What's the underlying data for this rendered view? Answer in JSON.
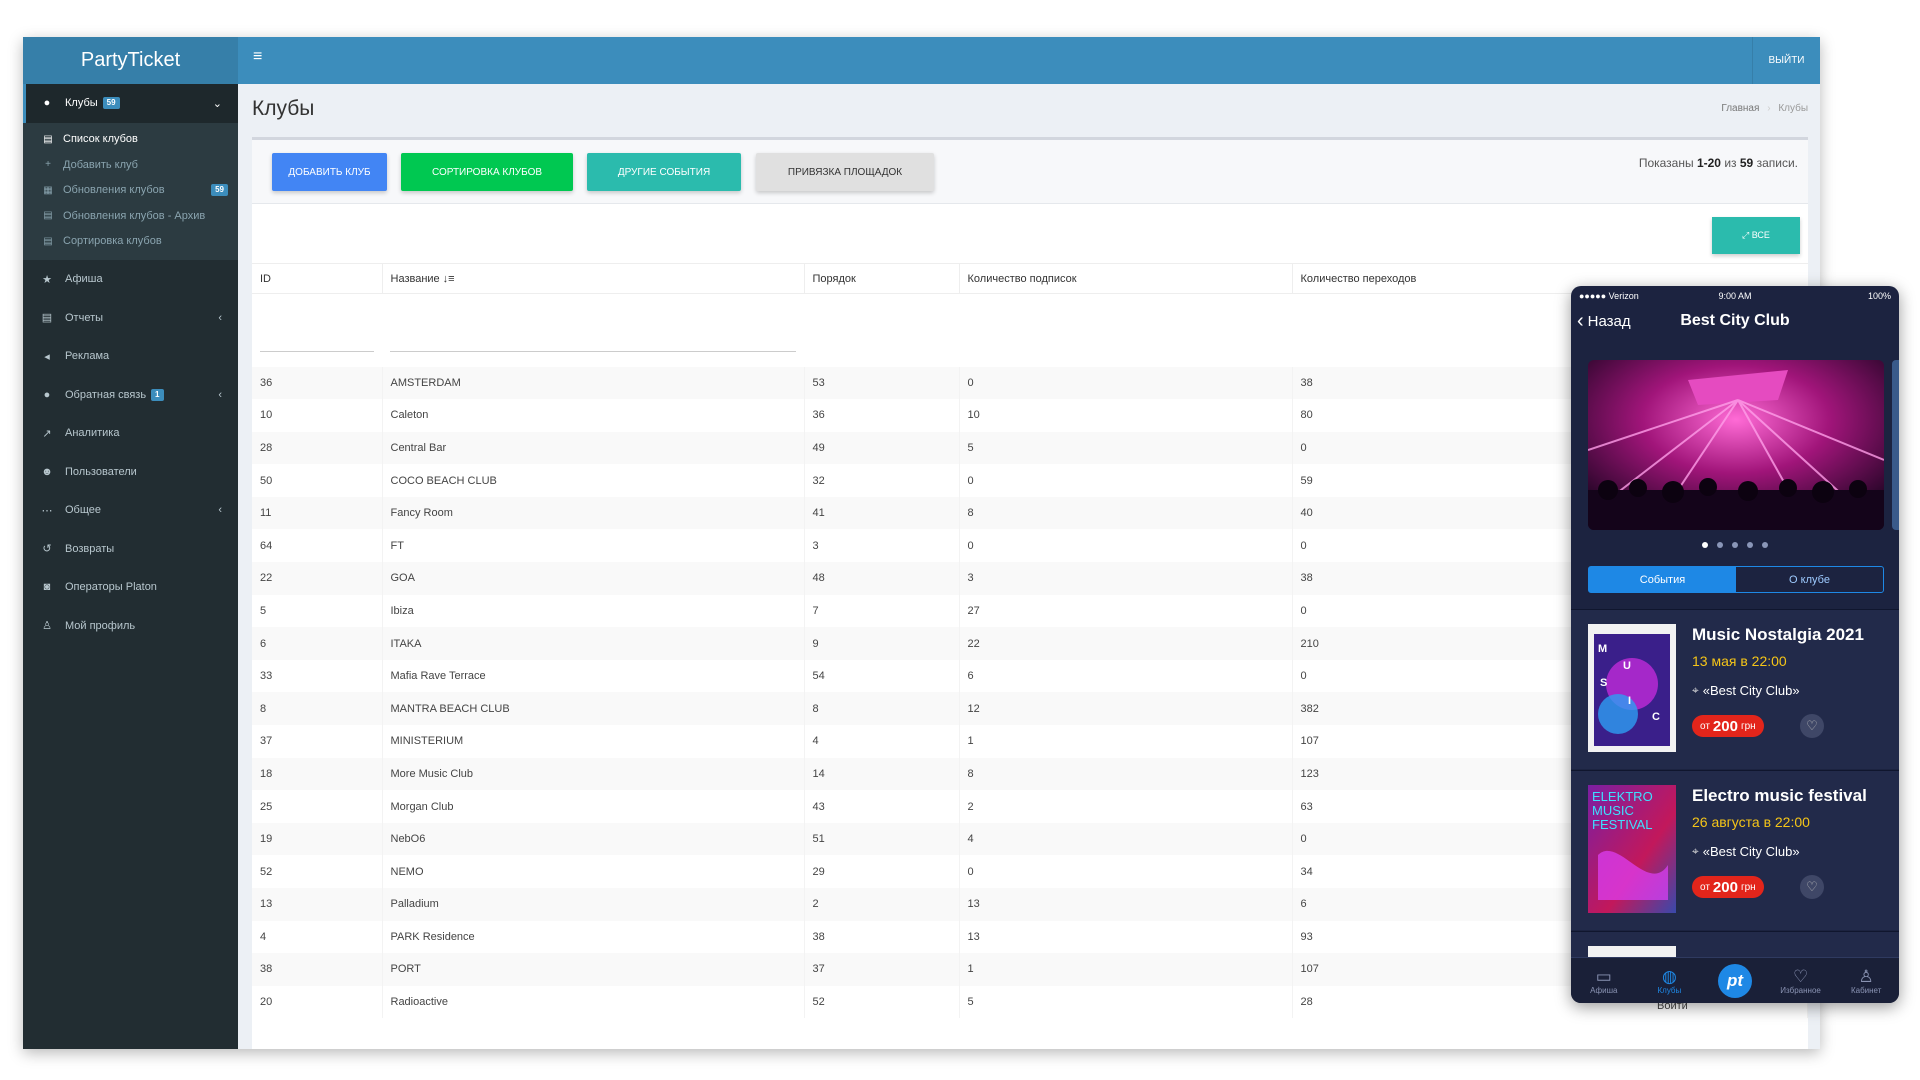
{
  "brand": "PartyTicket",
  "topbar": {
    "menu_icon": "≡",
    "logout": "ВЫЙТИ"
  },
  "sidebar": {
    "items": [
      {
        "icon": "●",
        "label": "Клубы",
        "badge": "59",
        "chev": "⌄"
      },
      {
        "icon": "★",
        "label": "Афиша"
      },
      {
        "icon": "▤",
        "label": "Отчеты",
        "chev": "‹"
      },
      {
        "icon": "◂",
        "label": "Реклама"
      },
      {
        "icon": "●",
        "label": "Обратная связь",
        "badge": "1",
        "chev": "‹"
      },
      {
        "icon": "↗",
        "label": "Аналитика"
      },
      {
        "icon": "☻",
        "label": "Пользователи"
      },
      {
        "icon": "⋯",
        "label": "Общее",
        "chev": "‹"
      },
      {
        "icon": "↺",
        "label": "Возвраты"
      },
      {
        "icon": "◙",
        "label": "Операторы Platon"
      },
      {
        "icon": "♙",
        "label": "Мой профиль"
      }
    ],
    "submenu": [
      {
        "icon": "▤",
        "label": "Список клубов"
      },
      {
        "icon": "+",
        "label": "Добавить клуб"
      },
      {
        "icon": "▦",
        "label": "Обновления клубов",
        "badge": "59"
      },
      {
        "icon": "▤",
        "label": "Обновления клубов - Архив"
      },
      {
        "icon": "▤",
        "label": "Сортировка клубов"
      }
    ]
  },
  "page": {
    "title": "Клубы",
    "breadcrumb": {
      "home": "Главная",
      "sep": "›",
      "current": "Клубы"
    }
  },
  "toolbar": {
    "add": "ДОБАВИТЬ КЛУБ",
    "sort": "СОРТИРОВКА КЛУБОВ",
    "events": "ДРУГИЕ СОБЫТИЯ",
    "bind": "ПРИВЯЗКА ПЛОЩАДОК",
    "shown_prefix": "Показаны",
    "shown_range": "1-20",
    "shown_of": "из",
    "shown_total": "59",
    "shown_suffix": "записи.",
    "all": "⤢ ВСЕ"
  },
  "table": {
    "headers": [
      "ID",
      "Название",
      "Порядок",
      "Количество подписок",
      "Количество переходов"
    ],
    "rows": [
      [
        "36",
        "AMSTERDAM",
        "53",
        "0",
        "38"
      ],
      [
        "10",
        "Caleton",
        "36",
        "10",
        "80"
      ],
      [
        "28",
        "Central Bar",
        "49",
        "5",
        "0"
      ],
      [
        "50",
        "COCO BEACH CLUB",
        "32",
        "0",
        "59"
      ],
      [
        "11",
        "Fancy Room",
        "41",
        "8",
        "40"
      ],
      [
        "64",
        "FT",
        "3",
        "0",
        "0"
      ],
      [
        "22",
        "GOA",
        "48",
        "3",
        "38"
      ],
      [
        "5",
        "Ibiza",
        "7",
        "27",
        "0"
      ],
      [
        "6",
        "ITAKA",
        "9",
        "22",
        "210"
      ],
      [
        "33",
        "Mafia Rave Terrace",
        "54",
        "6",
        "0"
      ],
      [
        "8",
        "MANTRA BEACH CLUB",
        "8",
        "12",
        "382"
      ],
      [
        "37",
        "MINISTERIUM",
        "4",
        "1",
        "107"
      ],
      [
        "18",
        "More Music Club",
        "14",
        "8",
        "123"
      ],
      [
        "25",
        "Morgan Club",
        "43",
        "2",
        "63"
      ],
      [
        "19",
        "NebO6",
        "51",
        "4",
        "0"
      ],
      [
        "52",
        "NEMO",
        "29",
        "0",
        "34"
      ],
      [
        "13",
        "Palladium",
        "2",
        "13",
        "6"
      ],
      [
        "4",
        "PARK Residence",
        "38",
        "13",
        "93"
      ],
      [
        "38",
        "PORT",
        "37",
        "1",
        "107"
      ],
      [
        "20",
        "Radioactive",
        "52",
        "5",
        "28"
      ]
    ],
    "login_link": "Войти"
  },
  "phone": {
    "status": {
      "carrier": "●●●●● Verizon",
      "time": "9:00 AM",
      "battery": "100%"
    },
    "back": "Назад",
    "title": "Best City Club",
    "seg_events": "События",
    "seg_about": "О клубе",
    "events": [
      {
        "title": "Music Nostalgia 2021",
        "date": "13 мая в 22:00",
        "venue": "«Best City Club»",
        "price_from": "от",
        "price": "200",
        "currency": "грн",
        "poster_text": "M U S I C 2021"
      },
      {
        "title": "Electro music festival",
        "date": "26 августа в 22:00",
        "venue": "«Best City Club»",
        "price_from": "от",
        "price": "200",
        "currency": "грн",
        "poster_text": "ELEKTRO MUSIC FESTIVAL"
      }
    ],
    "tabs": [
      {
        "icon": "▭",
        "label": "Афиша"
      },
      {
        "icon": "◍",
        "label": "Клубы"
      },
      {
        "icon": "pt",
        "label": ""
      },
      {
        "icon": "♡",
        "label": "Избранное"
      },
      {
        "icon": "♙",
        "label": "Кабинет"
      }
    ]
  }
}
